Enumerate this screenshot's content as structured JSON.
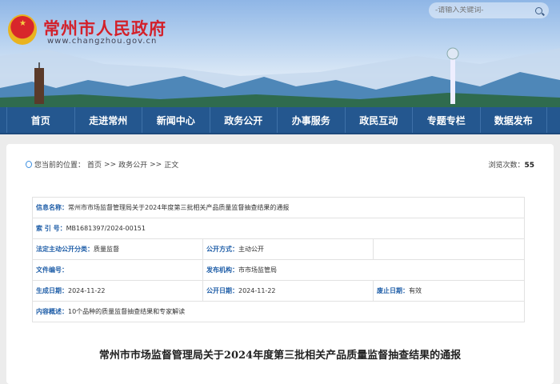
{
  "header": {
    "site_title": "常州市人民政府",
    "site_url": "www.changzhou.gov.cn",
    "emblem_symbol": "★",
    "search_placeholder": "-请输入关键词-"
  },
  "nav": [
    "首页",
    "走进常州",
    "新闻中心",
    "政务公开",
    "办事服务",
    "政民互动",
    "专题专栏",
    "数据发布"
  ],
  "breadcrumb": {
    "label": "您当前的位置：",
    "items": [
      "首页",
      ">>",
      "政务公开",
      ">>",
      "正文"
    ]
  },
  "views": {
    "label": "浏览次数：",
    "count": "55"
  },
  "info": {
    "name_label": "信息名称：",
    "name": "常州市市场监督管理局关于2024年度第三批相关产品质量监督抽查结果的通报",
    "index_label": "索 引 号：",
    "index": "MB1681397/2024-00151",
    "category_label": "法定主动公开分类：",
    "category": "质量监督",
    "method_label": "公开方式：",
    "method": "主动公开",
    "docno_label": "文件编号：",
    "docno": "",
    "org_label": "发布机构：",
    "org": "市市场监管局",
    "created_label": "生成日期：",
    "created": "2024-11-22",
    "public_label": "公开日期：",
    "public": "2024-11-22",
    "expire_label": "废止日期：",
    "expire": "有效",
    "summary_label": "内容概述：",
    "summary": "10个品种的质量监督抽查结果和专家解读"
  },
  "article_title": "常州市市场监督管理局关于2024年度第三批相关产品质量监督抽查结果的通报"
}
